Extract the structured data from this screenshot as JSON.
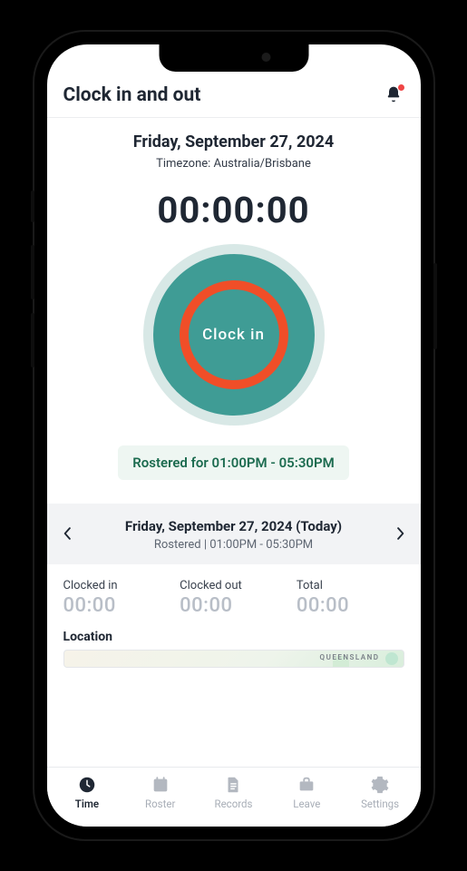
{
  "header": {
    "title": "Clock in and out"
  },
  "main": {
    "date": "Friday, September 27, 2024",
    "timezone_label": "Timezone: Australia/Brisbane",
    "timer": "00:00:00",
    "clock_button_label": "Clock  in",
    "rostered_text": "Rostered for 01:00PM - 05:30PM"
  },
  "day_nav": {
    "date": "Friday, September 27, 2024 (Today)",
    "subtext": "Rostered | 01:00PM - 05:30PM"
  },
  "summary": {
    "clocked_in_label": "Clocked in",
    "clocked_in_value": "00:00",
    "clocked_out_label": "Clocked out",
    "clocked_out_value": "00:00",
    "total_label": "Total",
    "total_value": "00:00"
  },
  "location": {
    "label": "Location",
    "region": "QUEENSLAND"
  },
  "tabs": {
    "time": "Time",
    "roster": "Roster",
    "records": "Records",
    "leave": "Leave",
    "settings": "Settings"
  }
}
